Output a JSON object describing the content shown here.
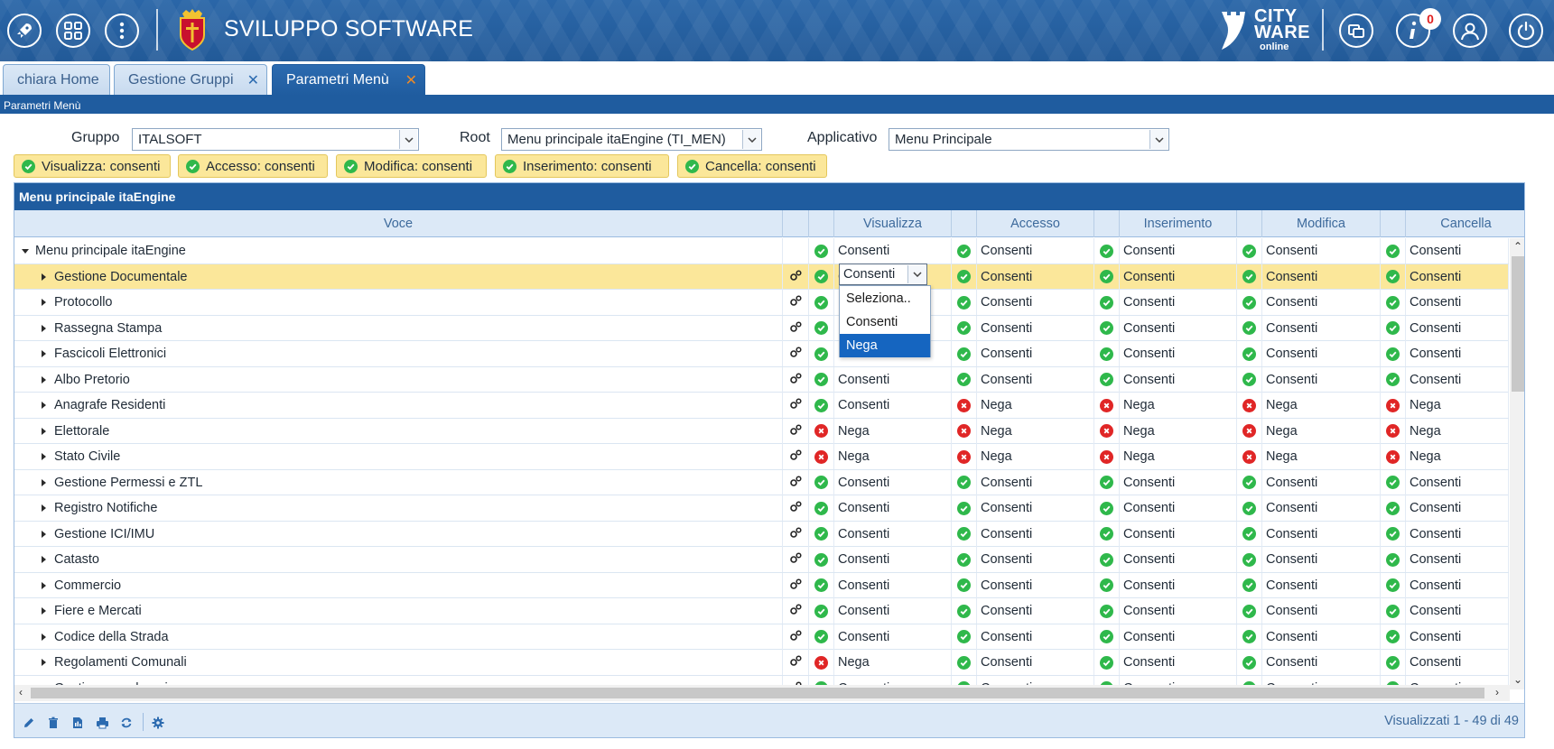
{
  "header": {
    "title": "SVILUPPO SOFTWARE",
    "brand_line1": "CITY",
    "brand_line2": "WARE",
    "brand_line3": "online",
    "notification_count": "0",
    "icons": [
      "rocket-icon",
      "apps-grid-icon",
      "more-vertical-icon",
      "windows-icon",
      "info-icon",
      "user-icon",
      "power-icon"
    ]
  },
  "tabs": [
    {
      "label": "chiara Home"
    },
    {
      "label": "Gestione Gruppi"
    },
    {
      "label": "Parametri Menù"
    }
  ],
  "subtitle": "Parametri Menù",
  "filters": {
    "gruppo_label": "Gruppo",
    "gruppo_value": "ITALSOFT",
    "root_label": "Root",
    "root_value": "Menu principale itaEngine (TI_MEN)",
    "applicativo_label": "Applicativo",
    "applicativo_value": "Menu Principale"
  },
  "chips": [
    {
      "label": "Visualizza: consenti"
    },
    {
      "label": "Accesso: consenti"
    },
    {
      "label": "Modifica: consenti"
    },
    {
      "label": "Inserimento: consenti"
    },
    {
      "label": "Cancella: consenti"
    }
  ],
  "grid": {
    "caption": "Menu principale itaEngine",
    "columns": [
      "Voce",
      "Visualizza",
      "Accesso",
      "Inserimento",
      "Modifica",
      "Cancella"
    ],
    "rows": [
      {
        "voce": "Menu principale itaEngine",
        "root": true,
        "v": "Consenti",
        "a": "Consenti",
        "i": "Consenti",
        "m": "Consenti",
        "c": "Consenti"
      },
      {
        "voce": "Gestione Documentale",
        "v": "Consenti",
        "a": "Consenti",
        "i": "Consenti",
        "m": "Consenti",
        "c": "Consenti"
      },
      {
        "voce": "Protocollo",
        "v": "",
        "a": "Consenti",
        "i": "Consenti",
        "m": "Consenti",
        "c": "Consenti"
      },
      {
        "voce": "Rassegna Stampa",
        "v": "",
        "a": "Consenti",
        "i": "Consenti",
        "m": "Consenti",
        "c": "Consenti"
      },
      {
        "voce": "Fascicoli Elettronici",
        "v": "",
        "a": "Consenti",
        "i": "Consenti",
        "m": "Consenti",
        "c": "Consenti"
      },
      {
        "voce": "Albo Pretorio",
        "v": "Consenti",
        "a": "Consenti",
        "i": "Consenti",
        "m": "Consenti",
        "c": "Consenti"
      },
      {
        "voce": "Anagrafe Residenti",
        "v": "Consenti",
        "a": "Nega",
        "i": "Nega",
        "m": "Nega",
        "c": "Nega"
      },
      {
        "voce": "Elettorale",
        "v": "Nega",
        "a": "Nega",
        "i": "Nega",
        "m": "Nega",
        "c": "Nega"
      },
      {
        "voce": "Stato Civile",
        "v": "Nega",
        "a": "Nega",
        "i": "Nega",
        "m": "Nega",
        "c": "Nega"
      },
      {
        "voce": "Gestione Permessi e ZTL",
        "v": "Consenti",
        "a": "Consenti",
        "i": "Consenti",
        "m": "Consenti",
        "c": "Consenti"
      },
      {
        "voce": "Registro Notifiche",
        "v": "Consenti",
        "a": "Consenti",
        "i": "Consenti",
        "m": "Consenti",
        "c": "Consenti"
      },
      {
        "voce": "Gestione ICI/IMU",
        "v": "Consenti",
        "a": "Consenti",
        "i": "Consenti",
        "m": "Consenti",
        "c": "Consenti"
      },
      {
        "voce": "Catasto",
        "v": "Consenti",
        "a": "Consenti",
        "i": "Consenti",
        "m": "Consenti",
        "c": "Consenti"
      },
      {
        "voce": "Commercio",
        "v": "Consenti",
        "a": "Consenti",
        "i": "Consenti",
        "m": "Consenti",
        "c": "Consenti"
      },
      {
        "voce": "Fiere e Mercati",
        "v": "Consenti",
        "a": "Consenti",
        "i": "Consenti",
        "m": "Consenti",
        "c": "Consenti"
      },
      {
        "voce": "Codice della Strada",
        "v": "Consenti",
        "a": "Consenti",
        "i": "Consenti",
        "m": "Consenti",
        "c": "Consenti"
      },
      {
        "voce": "Regolamenti Comunali",
        "v": "Nega",
        "a": "Consenti",
        "i": "Consenti",
        "m": "Consenti",
        "c": "Consenti"
      },
      {
        "voce": "Gestione parcheggi",
        "v": "Consenti",
        "a": "Consenti",
        "i": "Consenti",
        "m": "Consenti",
        "c": "Consenti"
      }
    ],
    "dropdown": {
      "current": "Consenti",
      "options": [
        "Seleziona..",
        "Consenti",
        "Nega"
      ],
      "highlighted": "Nega"
    }
  },
  "footer": {
    "count_text": "Visualizzati 1 - 49 di 49",
    "tools": [
      "edit-icon",
      "delete-icon",
      "export-icon",
      "print-icon",
      "refresh-icon",
      "settings-icon"
    ]
  },
  "colors": {
    "header_blue": "#225a98",
    "allow_green": "#2fb84b",
    "deny_red": "#e02626",
    "chip_yellow": "#fbe79a"
  }
}
